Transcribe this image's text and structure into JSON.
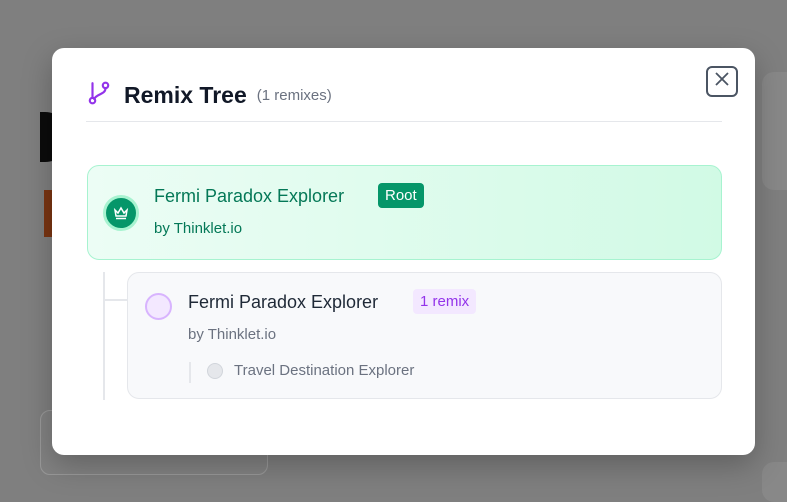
{
  "modal": {
    "title": "Remix Tree",
    "count": "(1 remixes)",
    "close_label": "Close",
    "root": {
      "title": "Fermi Paradox Explorer",
      "badge": "Root",
      "author": "by Thinklet.io"
    },
    "child": {
      "title": "Fermi Paradox Explorer",
      "badge": "1 remix",
      "author": "by Thinklet.io",
      "children": [
        {
          "title": "Travel Destination Explorer"
        }
      ]
    }
  },
  "colors": {
    "accent": "#9333ea",
    "root_green": "#059669",
    "overlay": "#7f7f7f"
  }
}
